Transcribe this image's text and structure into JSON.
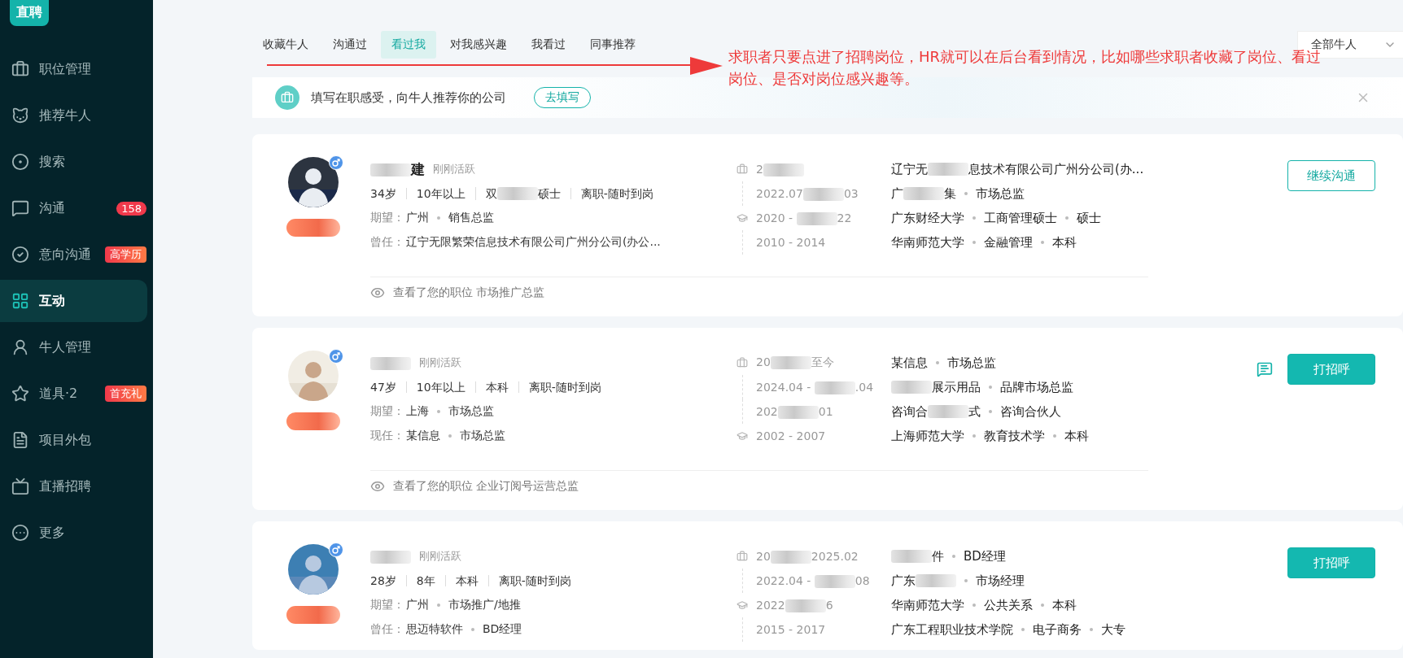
{
  "logo": {
    "text": "直聘"
  },
  "sidebar": {
    "items": [
      {
        "label": "职位管理",
        "selected": false
      },
      {
        "label": "推荐牛人",
        "selected": false
      },
      {
        "label": "搜索",
        "selected": false
      },
      {
        "label": "沟通",
        "selected": false,
        "badge": {
          "text": "158",
          "kind": "count"
        }
      },
      {
        "label": "意向沟通",
        "selected": false,
        "badge": {
          "text": "高学历",
          "kind": "tag"
        }
      },
      {
        "label": "互动",
        "selected": true
      },
      {
        "label": "牛人管理",
        "selected": false
      },
      {
        "label": "道具·2",
        "selected": false,
        "badge": {
          "text": "首充礼",
          "kind": "tag"
        }
      },
      {
        "label": "项目外包",
        "selected": false
      },
      {
        "label": "直播招聘",
        "selected": false
      },
      {
        "label": "更多",
        "selected": false
      }
    ]
  },
  "tabs": [
    {
      "label": "收藏牛人",
      "selected": false
    },
    {
      "label": "沟通过",
      "selected": false
    },
    {
      "label": "看过我",
      "selected": true
    },
    {
      "label": "对我感兴趣",
      "selected": false
    },
    {
      "label": "我看过",
      "selected": false
    },
    {
      "label": "同事推荐",
      "selected": false
    }
  ],
  "filter": {
    "value": "全部牛人"
  },
  "annotation": {
    "text": "求职者只要点进了招聘岗位，HR就可以在后台看到情况，比如哪些求职者收藏了岗位、看过岗位、是否对岗位感兴趣等。"
  },
  "banner": {
    "text": "填写在职感受，向牛人推荐你的公司",
    "button": "去填写"
  },
  "candidates": [
    {
      "name": [
        {
          "kind": "blur"
        },
        "建"
      ],
      "activity": "刚刚活跃",
      "tags": [
        "34岁",
        "10年以上",
        [
          "双",
          {
            "kind": "blur"
          },
          " 硕士"
        ],
        "离职-随时到岗"
      ],
      "lines": [
        {
          "label": "期望：",
          "values": [
            "广州",
            "销售总监"
          ]
        },
        {
          "label": "曾任：",
          "values": [
            "辽宁无限繁荣信息技术有限公司广州分公司(办公..."
          ]
        }
      ],
      "timeline": [
        {
          "kind": "work",
          "dates": [
            "2",
            {
              "kind": "blur"
            }
          ]
        },
        {
          "kind": "none",
          "dates": [
            "2022.07",
            {
              "kind": "blur"
            },
            "03"
          ]
        },
        {
          "kind": "edu",
          "dates": [
            "2020 - ",
            {
              "kind": "blur"
            },
            "22"
          ]
        },
        {
          "kind": "none",
          "dates": [
            "2010 - 2014"
          ]
        }
      ],
      "details": [
        [
          [
            "辽宁无",
            {
              "kind": "blur"
            },
            "息技术有限公司广州分公司(办..."
          ]
        ],
        [
          [
            "广",
            {
              "kind": "blur"
            },
            "集"
          ],
          "市场总监"
        ],
        [
          "广东财经大学",
          "工商管理硕士",
          "硕士"
        ],
        [
          "华南师范大学",
          "金融管理",
          "本科"
        ]
      ],
      "message_icon": false,
      "action": {
        "label": "继续沟通",
        "kind": "outline"
      },
      "viewed": "查看了您的职位 市场推广总监"
    },
    {
      "name": [
        {
          "kind": "blur"
        }
      ],
      "activity": "刚刚活跃",
      "tags": [
        "47岁",
        "10年以上",
        "本科",
        "离职-随时到岗"
      ],
      "lines": [
        {
          "label": "期望：",
          "values": [
            "上海",
            "市场总监"
          ]
        },
        {
          "label": "现任：",
          "values": [
            "某信息",
            "市场总监"
          ]
        }
      ],
      "timeline": [
        {
          "kind": "work",
          "dates": [
            "20",
            {
              "kind": "blur"
            },
            "至今"
          ]
        },
        {
          "kind": "none",
          "dates": [
            "2024.04 - ",
            {
              "kind": "blur"
            },
            ".04"
          ]
        },
        {
          "kind": "none",
          "dates": [
            "202",
            {
              "kind": "blur"
            },
            "01"
          ]
        },
        {
          "kind": "edu",
          "dates": [
            "2002 - 2007"
          ]
        }
      ],
      "details": [
        [
          "某信息",
          "市场总监"
        ],
        [
          [
            {
              "kind": "blur"
            },
            "展示用品"
          ],
          "品牌市场总监"
        ],
        [
          [
            "咨询合",
            {
              "kind": "blur"
            },
            "式"
          ],
          "咨询合伙人"
        ],
        [
          "上海师范大学",
          "教育技术学",
          "本科"
        ]
      ],
      "message_icon": true,
      "action": {
        "label": "打招呼",
        "kind": "filled"
      },
      "viewed": "查看了您的职位 企业订阅号运营总监"
    },
    {
      "name": [
        {
          "kind": "blur"
        }
      ],
      "activity": "刚刚活跃",
      "tags": [
        "28岁",
        "8年",
        "本科",
        "离职-随时到岗"
      ],
      "lines": [
        {
          "label": "期望：",
          "values": [
            "广州",
            "市场推广/地推"
          ]
        },
        {
          "label": "曾任：",
          "values": [
            "思迈特软件",
            "BD经理"
          ]
        }
      ],
      "timeline": [
        {
          "kind": "work",
          "dates": [
            "20",
            {
              "kind": "blur"
            },
            "2025.02"
          ]
        },
        {
          "kind": "none",
          "dates": [
            "2022.04 - ",
            {
              "kind": "blur"
            },
            "08"
          ]
        },
        {
          "kind": "edu",
          "dates": [
            "2022",
            {
              "kind": "blur"
            },
            "6"
          ]
        },
        {
          "kind": "none",
          "dates": [
            "2015 - 2017"
          ]
        }
      ],
      "details": [
        [
          [
            {
              "kind": "blur"
            },
            "件"
          ],
          "BD经理"
        ],
        [
          [
            "广东",
            {
              "kind": "blur"
            }
          ],
          "市场经理"
        ],
        [
          "华南师范大学",
          "公共关系",
          "本科"
        ],
        [
          "广东工程职业技术学院",
          "电子商务",
          "大专"
        ]
      ],
      "message_icon": false,
      "action": {
        "label": "打招呼",
        "kind": "filled"
      }
    }
  ]
}
